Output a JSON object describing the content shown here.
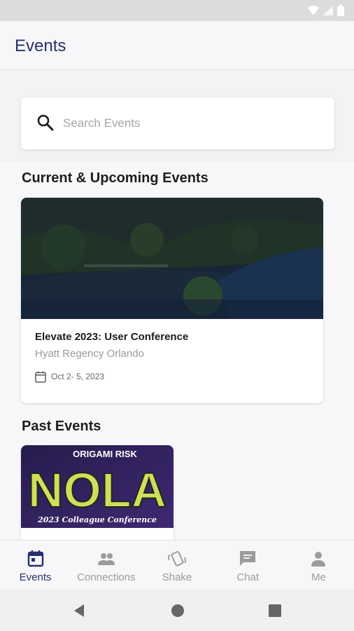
{
  "app": {
    "title": "Events"
  },
  "search": {
    "placeholder": "Search Events"
  },
  "sections": {
    "current": "Current & Upcoming Events",
    "past": "Past Events"
  },
  "current_events": [
    {
      "name": "Elevate 2023: User Conference",
      "venue": "Hyatt Regency Orlando",
      "date": "Oct  2- 5, 2023"
    }
  ],
  "past_events": [
    {
      "banner_brand": "ORIGAMI RISK",
      "banner_title": "NOLA",
      "banner_subtitle": "2023 Colleague Conference"
    }
  ],
  "bottom_nav": {
    "items": [
      {
        "label": "Events",
        "icon": "calendar-icon",
        "active": true
      },
      {
        "label": "Connections",
        "icon": "people-icon",
        "active": false
      },
      {
        "label": "Shake",
        "icon": "shake-icon",
        "active": false
      },
      {
        "label": "Chat",
        "icon": "chat-icon",
        "active": false
      },
      {
        "label": "Me",
        "icon": "person-icon",
        "active": false
      }
    ]
  },
  "colors": {
    "accent": "#27306a",
    "muted": "#9b9b9b"
  }
}
